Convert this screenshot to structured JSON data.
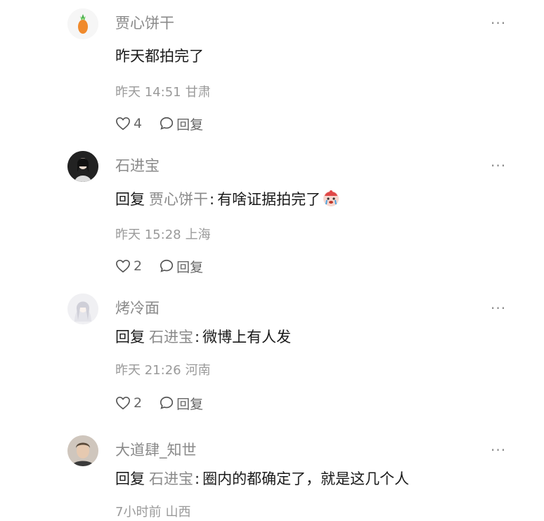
{
  "comments": [
    {
      "avatar_icon": "carrot-avatar",
      "username": "贾心饼干",
      "is_reply": false,
      "text": "昨天都拍完了",
      "time": "昨天 14:51",
      "location": "甘肃",
      "likes": "4",
      "reply_label": "回复",
      "more": "···"
    },
    {
      "avatar_icon": "person-avatar-dark",
      "username": "石进宝",
      "is_reply": true,
      "reply_prefix": "回复",
      "reply_target": "贾心饼干",
      "colon": ":",
      "text": "有啥证据拍完了",
      "emoji": "crying-emoji",
      "time": "昨天 15:28",
      "location": "上海",
      "likes": "2",
      "reply_label": "回复",
      "more": "···"
    },
    {
      "avatar_icon": "anime-avatar-light",
      "username": "烤冷面",
      "is_reply": true,
      "reply_prefix": "回复",
      "reply_target": "石进宝",
      "colon": ":",
      "text": "微博上有人发",
      "time": "昨天 21:26",
      "location": "河南",
      "likes": "2",
      "reply_label": "回复",
      "more": "···"
    },
    {
      "avatar_icon": "person-avatar-photo",
      "username": "大道肆_知世",
      "is_reply": true,
      "reply_prefix": "回复",
      "reply_target": "石进宝",
      "colon": ":",
      "text": "圈内的都确定了，就是这几个人",
      "time": "7小时前",
      "location": "山西",
      "more": "···"
    }
  ],
  "colors": {
    "primary_text": "#1a1a1a",
    "secondary_text": "#8a8a8a",
    "meta_text": "#9a9a9a",
    "action_text": "#666666"
  }
}
